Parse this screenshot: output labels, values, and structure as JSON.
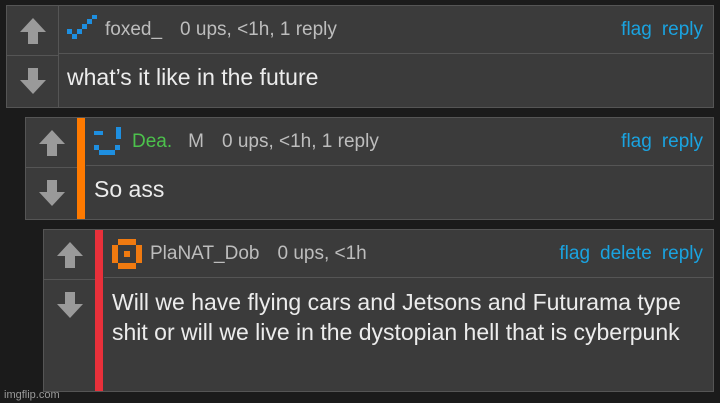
{
  "comments": [
    {
      "username": "foxed_",
      "mod": "",
      "stats": "0 ups, <1h, 1 reply",
      "actions": [
        "flag",
        "reply"
      ],
      "text": "what’s it like in the future"
    },
    {
      "username": "Dea.",
      "mod": "M",
      "stats": "0 ups, <1h, 1 reply",
      "actions": [
        "flag",
        "reply"
      ],
      "text": "So ass"
    },
    {
      "username": "PlaNAT_Dob",
      "mod": "",
      "stats": "0 ups, <1h",
      "actions": [
        "flag",
        "delete",
        "reply"
      ],
      "text": "Will we have flying cars and Jetsons and Futurama type shit or will we live in the dystopian hell that is cyberpunk"
    }
  ],
  "watermark": "imgflip.com",
  "icons": {
    "upvote": "up-arrow-icon",
    "downvote": "down-arrow-icon",
    "avatar1": "blue-pixel-check-avatar",
    "avatar2": "blue-pixel-smile-avatar",
    "avatar3": "orange-pixel-ring-avatar"
  },
  "colors": {
    "link": "#1aa3e0",
    "reply_stripe_1": "#ff7a00",
    "reply_stripe_2": "#e8303a",
    "username_green": "#4cc24c"
  }
}
